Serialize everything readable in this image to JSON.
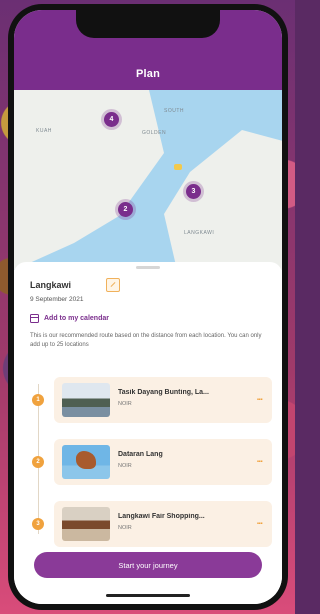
{
  "header": {
    "title": "Plan"
  },
  "map": {
    "labels": [
      "KUAH",
      "GOLDEN",
      "SOUTH",
      "LANGKAWI"
    ],
    "markers": [
      "4",
      "3",
      "2"
    ],
    "marker_color": "#7a2d8c"
  },
  "trip": {
    "title": "Langkawi",
    "date": "9 September 2021",
    "calendar_label": "Add to my calendar",
    "description": "This is our recommended route based on the distance from each location. You can only add up to 25 locations"
  },
  "stops": [
    {
      "number": "1",
      "title": "Tasik Dayang Bunting, La...",
      "subtitle": "NOIR"
    },
    {
      "number": "2",
      "title": "Dataran Lang",
      "subtitle": "NOIR"
    },
    {
      "number": "3",
      "title": "Langkawi Fair Shopping...",
      "subtitle": "NOIR"
    }
  ],
  "more_label": "...",
  "cta": {
    "label": "Start your journey"
  },
  "colors": {
    "brand": "#7a2d8c",
    "accent": "#f0a23e",
    "card_bg": "#fbf0e4"
  }
}
